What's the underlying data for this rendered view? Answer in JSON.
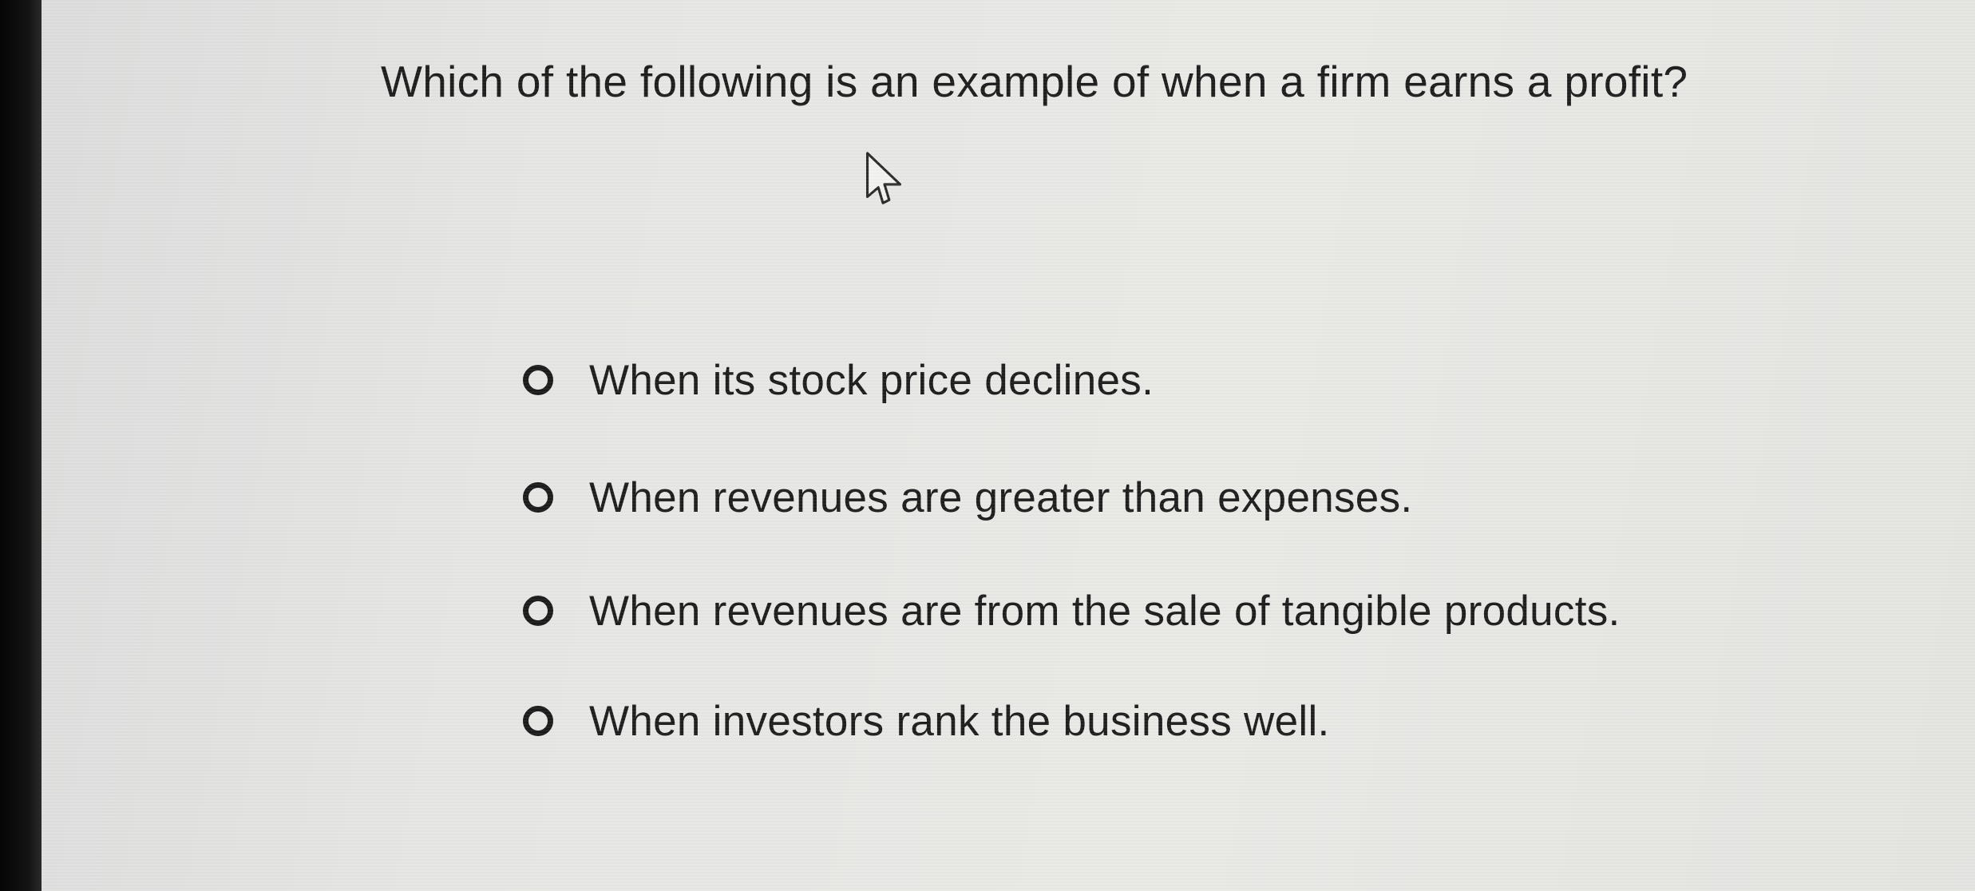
{
  "question": {
    "text": "Which of the following is an example of when a firm earns a profit?"
  },
  "options": [
    {
      "label": "When its stock price declines.",
      "selected": false
    },
    {
      "label": "When revenues are greater than expenses.",
      "selected": false
    },
    {
      "label": "When revenues are from the sale of tangible products.",
      "selected": false
    },
    {
      "label": "When investors rank the business well.",
      "selected": false
    }
  ],
  "cursor": {
    "icon": "hand-pointer-cursor-icon"
  }
}
